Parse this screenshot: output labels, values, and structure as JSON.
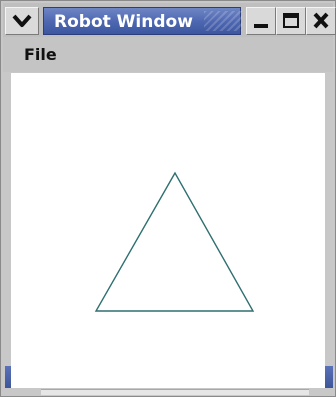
{
  "window": {
    "title": "Robot Window",
    "title_color": "#4f68b2"
  },
  "menu": {
    "items": [
      {
        "label": "File"
      }
    ]
  },
  "titlebar_buttons": {
    "menu_icon": "chevron-down-icon",
    "minimize_icon": "minimize-icon",
    "maximize_icon": "maximize-icon",
    "close_icon": "close-icon"
  },
  "drawing": {
    "shape": "triangle",
    "stroke_color": "#2f6f70"
  }
}
